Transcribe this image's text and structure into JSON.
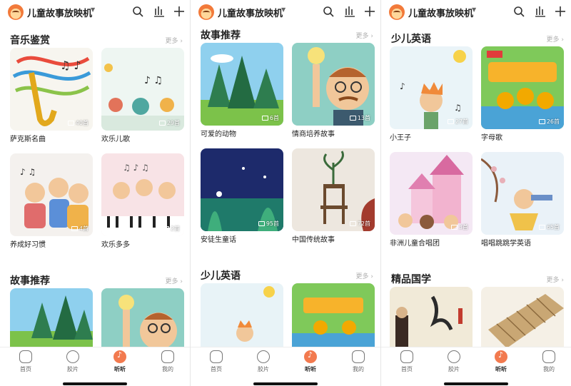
{
  "app": {
    "title": "儿童故事放映机",
    "more_label": "更多"
  },
  "tabs": [
    "首页",
    "胶片",
    "听听",
    "我的"
  ],
  "screens": [
    {
      "sections": [
        {
          "title": "音乐鉴赏",
          "cards": [
            {
              "label": "萨克斯名曲",
              "count": "40首"
            },
            {
              "label": "欢乐儿歌",
              "count": "29首"
            },
            {
              "label": "养成好习惯",
              "count": "4首"
            },
            {
              "label": "欢乐多多",
              "count": "2首"
            }
          ]
        },
        {
          "title": "故事推荐"
        }
      ]
    },
    {
      "sections": [
        {
          "title": "故事推荐",
          "cards": [
            {
              "label": "可爱的动物",
              "count": "6首"
            },
            {
              "label": "情商培养故事",
              "count": "13首"
            },
            {
              "label": "安徒生童话",
              "count": "95首"
            },
            {
              "label": "中国传统故事",
              "count": "72首"
            }
          ]
        },
        {
          "title": "少儿英语"
        }
      ]
    },
    {
      "sections": [
        {
          "title": "少儿英语",
          "cards": [
            {
              "label": "小王子",
              "count": "27首"
            },
            {
              "label": "字母歌",
              "count": "26首"
            },
            {
              "label": "非洲儿童合唱团",
              "count": "3首"
            },
            {
              "label": "唱唱跳跳学英语",
              "count": "65首"
            }
          ]
        },
        {
          "title": "精品国学"
        }
      ]
    }
  ],
  "colors": {
    "accent": "#f27a4f",
    "more_text": "#b0b0b0"
  }
}
